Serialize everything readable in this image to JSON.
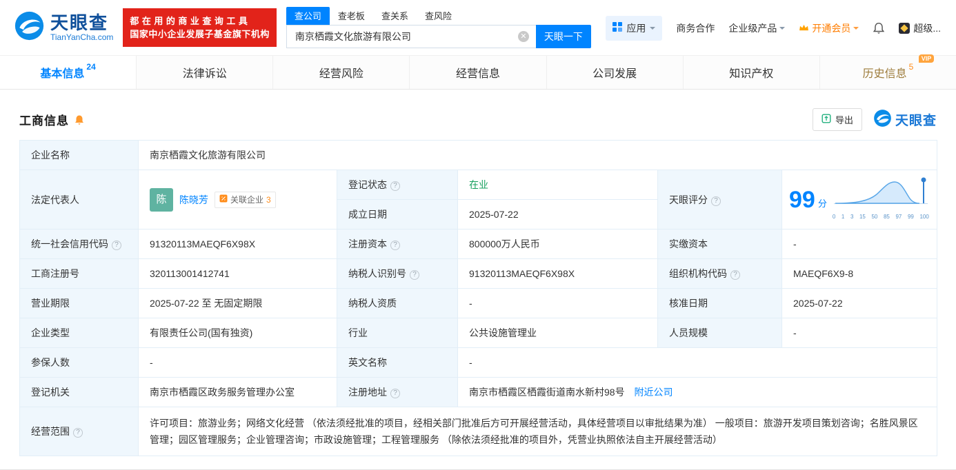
{
  "brand": {
    "name_cn": "天眼查",
    "name_en": "TianYanCha.com"
  },
  "header": {
    "slogan_line1": "都在用的商业查询工具",
    "slogan_line2": "国家中小企业发展子基金旗下机构",
    "search_tabs": [
      {
        "label": "查公司"
      },
      {
        "label": "查老板"
      },
      {
        "label": "查关系"
      },
      {
        "label": "查风险"
      }
    ],
    "search_value": "南京栖霞文化旅游有限公司",
    "search_button": "天眼一下",
    "apps_label": "应用",
    "cooperation_label": "商务合作",
    "enterprise_label": "企业级产品",
    "vip_label": "开通会员",
    "user_label": "超级..."
  },
  "tabs": [
    {
      "label": "基本信息",
      "count": "24"
    },
    {
      "label": "法律诉讼"
    },
    {
      "label": "经营风险"
    },
    {
      "label": "经营信息"
    },
    {
      "label": "公司发展"
    },
    {
      "label": "知识产权"
    },
    {
      "label": "历史信息",
      "count": "5",
      "vip_badge": "VIP"
    }
  ],
  "section": {
    "title": "工商信息",
    "export_label": "导出",
    "brand_label": "天眼查"
  },
  "company": {
    "name_label": "企业名称",
    "name": "南京栖霞文化旅游有限公司",
    "legal_label": "法定代表人",
    "legal_avatar": "陈",
    "legal_name": "陈晓芳",
    "related_label": "关联企业",
    "related_count": "3",
    "status_label": "登记状态",
    "status": "在业",
    "established_label": "成立日期",
    "established": "2025-07-22",
    "score_label": "天眼评分",
    "credit_label": "统一社会信用代码",
    "credit": "91320113MAEQF6X98X",
    "capital_label": "注册资本",
    "capital": "800000万人民币",
    "paid_label": "实缴资本",
    "paid": "-",
    "regno_label": "工商注册号",
    "regno": "320113001412741",
    "taxid_label": "纳税人识别号",
    "taxid": "91320113MAEQF6X98X",
    "orgcode_label": "组织机构代码",
    "orgcode": "MAEQF6X9-8",
    "term_label": "营业期限",
    "term": "2025-07-22 至 无固定期限",
    "taxqual_label": "纳税人资质",
    "taxqual": "-",
    "approve_label": "核准日期",
    "approve": "2025-07-22",
    "type_label": "企业类型",
    "type": "有限责任公司(国有独资)",
    "industry_label": "行业",
    "industry": "公共设施管理业",
    "scale_label": "人员规模",
    "scale": "-",
    "insured_label": "参保人数",
    "insured": "-",
    "enname_label": "英文名称",
    "enname": "-",
    "authority_label": "登记机关",
    "authority": "南京市栖霞区政务服务管理办公室",
    "address_label": "注册地址",
    "address": "南京市栖霞区栖霞街道南水新村98号",
    "nearby": "附近公司",
    "scope_label": "经营范围",
    "scope": "许可项目：旅游业务；网络文化经营 （依法须经批准的项目，经相关部门批准后方可开展经营活动，具体经营项目以审批结果为准） 一般项目：旅游开发项目策划咨询；名胜风景区管理；园区管理服务；企业管理咨询；市政设施管理；工程管理服务 （除依法须经批准的项目外，凭营业执照依法自主开展经营活动）"
  },
  "score_chart": {
    "score": "99",
    "unit": "分",
    "ticks": [
      "0",
      "1",
      "3",
      "15",
      "50",
      "85",
      "97",
      "99",
      "100"
    ]
  }
}
